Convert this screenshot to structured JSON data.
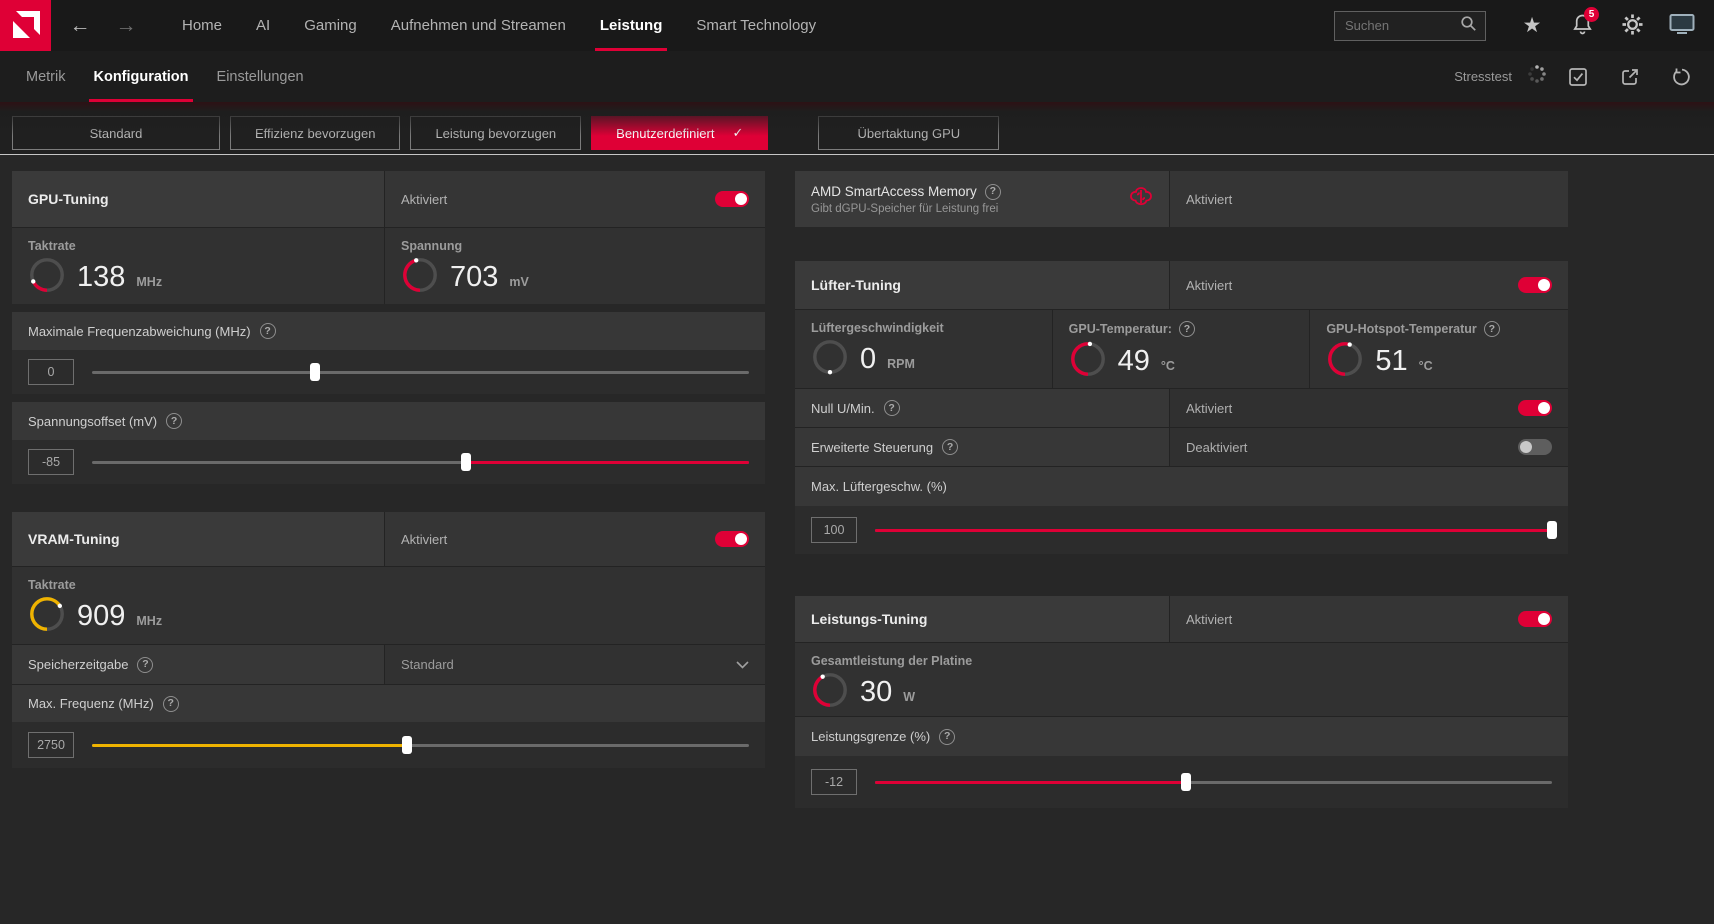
{
  "colors": {
    "accent": "#df0036",
    "yellow": "#efb300"
  },
  "icons": {
    "back": "←",
    "forward": "→",
    "star": "★",
    "check": "✓",
    "help": "?"
  },
  "topbar": {
    "nav": [
      {
        "label": "Home"
      },
      {
        "label": "AI"
      },
      {
        "label": "Gaming"
      },
      {
        "label": "Aufnehmen und Streamen"
      },
      {
        "label": "Leistung"
      },
      {
        "label": "Smart Technology"
      }
    ],
    "search_placeholder": "Suchen",
    "notification_count": "5"
  },
  "tabs": {
    "metrik": "Metrik",
    "konfiguration": "Konfiguration",
    "einstellungen": "Einstellungen",
    "stresstest": "Stresstest"
  },
  "presets": {
    "standard": "Standard",
    "efficiency": "Effizienz bevorzugen",
    "performance": "Leistung bevorzugen",
    "custom": "Benutzerdefiniert",
    "overclock_gpu": "Übertaktung GPU"
  },
  "gpu": {
    "title": "GPU-Tuning",
    "status": "Aktiviert",
    "clock": {
      "label": "Taktrate",
      "value": "138",
      "unit": "MHz",
      "fraction": 0.18
    },
    "voltage": {
      "label": "Spannung",
      "value": "703",
      "unit": "mV",
      "fraction": 0.46
    },
    "freq_dev": {
      "label": "Maximale Frequenzabweichung (MHz)",
      "value": "0",
      "percent": 34
    },
    "volt_offset": {
      "label": "Spannungsoffset (mV)",
      "value": "-85",
      "percent": 57
    }
  },
  "vram": {
    "title": "VRAM-Tuning",
    "status": "Aktiviert",
    "clock": {
      "label": "Taktrate",
      "value": "909",
      "unit": "MHz",
      "fraction": 0.66
    },
    "timing": {
      "label": "Speicherzeitgabe",
      "value": "Standard"
    },
    "max_freq": {
      "label": "Max. Frequenz (MHz)",
      "value": "2750",
      "percent": 48
    }
  },
  "sam": {
    "title": "AMD SmartAccess Memory",
    "subtitle": "Gibt dGPU-Speicher für Leistung frei",
    "status": "Aktiviert"
  },
  "fan": {
    "title": "Lüfter-Tuning",
    "status": "Aktiviert",
    "speed": {
      "label": "Lüftergeschwindigkeit",
      "value": "0",
      "unit": "RPM",
      "fraction": 0
    },
    "gpu_temp": {
      "label": "GPU-Temperatur:",
      "value": "49",
      "unit": "°C",
      "fraction": 0.52
    },
    "hotspot_temp": {
      "label": "GPU-Hotspot-Temperatur",
      "value": "51",
      "unit": "°C",
      "fraction": 0.55
    },
    "zero_rpm": {
      "label": "Null U/Min.",
      "status": "Aktiviert"
    },
    "advanced": {
      "label": "Erweiterte Steuerung",
      "status": "Deaktiviert"
    },
    "max_speed": {
      "label": "Max. Lüftergeschw. (%)",
      "value": "100",
      "percent": 100
    }
  },
  "power": {
    "title": "Leistungs-Tuning",
    "status": "Aktiviert",
    "board": {
      "label": "Gesamtleistung der Platine",
      "value": "30",
      "unit": "W",
      "fraction": 0.42
    },
    "limit": {
      "label": "Leistungsgrenze (%)",
      "value": "-12",
      "percent": 46
    }
  }
}
